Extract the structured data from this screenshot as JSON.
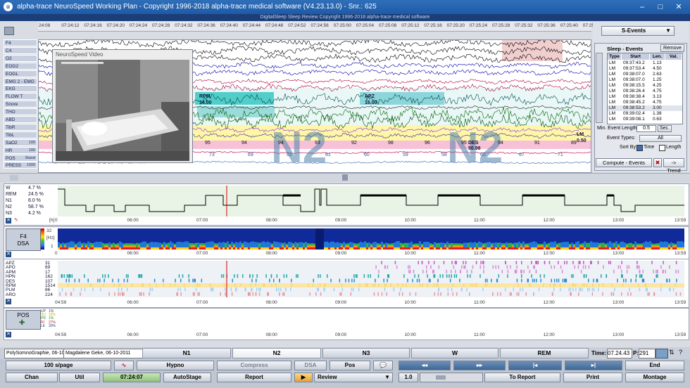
{
  "window": {
    "title": "alpha-trace NeuroSpeed Working Plan - Copyright 1996-2018 alpha-trace medical software (V4.23.13.0) - Snr.: 625",
    "subtitle": "DigitalSleep Sleep Review    Copyright 1996-2018 alpha-trace medical software",
    "app_icon": "α"
  },
  "timeline": {
    "ticks": [
      "24:08",
      "07:24:12",
      "07:24:16",
      "07:24:20",
      "07:24:24",
      "07:24:28",
      "07:24:32",
      "07:24:36",
      "07:24:40",
      "07:24:44",
      "07:24:48",
      "07:24:52",
      "07:24:56",
      "07:25:00",
      "07:25:04",
      "07:25:08",
      "07:25:12",
      "07:25:16",
      "07:25:20",
      "07:25:24",
      "07:25:28",
      "07:25:32",
      "07:25:36",
      "07:25:40",
      "07:25:44"
    ]
  },
  "channels": [
    {
      "label": "F4",
      "value": ""
    },
    {
      "label": "C4",
      "value": ""
    },
    {
      "label": "O2",
      "value": ""
    },
    {
      "label": "EOG2",
      "value": ""
    },
    {
      "label": "EOGL",
      "value": ""
    },
    {
      "label": "EMG 2 - EMG 1",
      "value": ""
    },
    {
      "label": "EKG",
      "value": ""
    },
    {
      "label": "FLOW T",
      "value": ""
    },
    {
      "label": "Snore",
      "value": ""
    },
    {
      "label": "THO",
      "value": ""
    },
    {
      "label": "ABD",
      "value": ""
    },
    {
      "label": "TibR",
      "value": ""
    },
    {
      "label": "TibL",
      "value": ""
    },
    {
      "label": "SaO2",
      "value": "100"
    },
    {
      "label": "HR",
      "value": "100"
    },
    {
      "label": "POS",
      "value": "Stand"
    },
    {
      "label": "PRESS",
      "value": "1000"
    }
  ],
  "overlay": {
    "stage_text_1": "N2",
    "stage_text_2": "N2",
    "rpm_label": "RPM",
    "rpm_value": "14.00",
    "apz_label": "APZ",
    "apz_value": "16.00",
    "des_label": "DES",
    "des_value": "50.98",
    "lm_label": "LM",
    "lm_value": "0.50",
    "sao2_values": [
      "95",
      "95",
      "96",
      "95",
      "95",
      "94",
      "94",
      "93",
      "92",
      "98",
      "96",
      "95",
      "94",
      "91",
      "89"
    ],
    "hr_values": [
      "62",
      "63",
      "64",
      "71",
      "73",
      "69",
      "61",
      "61",
      "60",
      "59",
      "58",
      "60",
      "67",
      "71"
    ]
  },
  "video": {
    "title": "NeuroSpeed Video"
  },
  "right_panel": {
    "event_type": "S-Events",
    "section_title": "Sleep - Events",
    "remove_label": "Remove",
    "col_type": "Type",
    "col_start": "Start",
    "col_len": "Len.",
    "col_val": "Val.",
    "rows": [
      {
        "type": "LM",
        "start": "09:37:43.2",
        "len": "1.13",
        "val": ""
      },
      {
        "type": "LM",
        "start": "09:37:53.4",
        "len": "4.50",
        "val": ""
      },
      {
        "type": "LM",
        "start": "09:38:07.0",
        "len": "2.63",
        "val": ""
      },
      {
        "type": "LM",
        "start": "09:38:07.0",
        "len": "1.25",
        "val": ""
      },
      {
        "type": "LM",
        "start": "09:38:15.5",
        "len": "4.25",
        "val": ""
      },
      {
        "type": "LM",
        "start": "09:38:26.4",
        "len": "4.75",
        "val": ""
      },
      {
        "type": "LM",
        "start": "09:38:38.4",
        "len": "3.13",
        "val": ""
      },
      {
        "type": "LM",
        "start": "09:38:45.2",
        "len": "4.75",
        "val": ""
      },
      {
        "type": "LM",
        "start": "09:38:53.2",
        "len": "3.00",
        "val": ""
      },
      {
        "type": "LM",
        "start": "09:39:02.4",
        "len": "1.38",
        "val": ""
      },
      {
        "type": "LM",
        "start": "09:39:08.1",
        "len": "0.63",
        "val": ""
      }
    ],
    "min_event_length_label": "Min. Event Length:",
    "min_event_length_value": "0.5",
    "sec_label": "Sec.",
    "event_types_label": "Event Types:",
    "event_types_value": "All",
    "sort_by_label": "Sort By:",
    "sort_time": "Time",
    "sort_length": "Length",
    "compute_label": "Compute - Events",
    "trend_label": "-> Trend"
  },
  "hypnogram": {
    "stages": [
      {
        "name": "W",
        "pct": "4.7 %"
      },
      {
        "name": "REM",
        "pct": "24.5 %"
      },
      {
        "name": "N1",
        "pct": "8.0 %"
      },
      {
        "name": "N2",
        "pct": "58.7 %"
      },
      {
        "name": "N3",
        "pct": "4.2 %"
      }
    ],
    "unit": "[h]",
    "ticks": [
      "0",
      "06:00",
      "07:00",
      "08:00",
      "09:00",
      "10:00",
      "11:00",
      "12:00",
      "13:00",
      "13:59"
    ]
  },
  "dsa": {
    "channel": "F4",
    "label": "DSA",
    "unit": "[Hz]",
    "y_ticks": [
      "32",
      "1"
    ],
    "ticks": [
      "0",
      "06:00",
      "07:00",
      "08:00",
      "09:00",
      "10:00",
      "11:00",
      "12:00",
      "13:00",
      "13:59"
    ]
  },
  "event_rows": [
    {
      "name": "APZ",
      "count": "31"
    },
    {
      "name": "APO",
      "count": "69"
    },
    {
      "name": "APM",
      "count": "17"
    },
    {
      "name": "HPN",
      "count": "162"
    },
    {
      "name": "DES",
      "count": "107"
    },
    {
      "name": "RPM",
      "count": "1514"
    },
    {
      "name": "PLM",
      "count": "86"
    },
    {
      "name": "ARO",
      "count": "224"
    }
  ],
  "event_ticks": [
    "04:59",
    "06:00",
    "07:00",
    "08:00",
    "09:00",
    "10:00",
    "11:00",
    "12:00",
    "13:00",
    "13:59"
  ],
  "position": {
    "label": "POS",
    "legend": [
      {
        "name": "UP",
        "pct": "1%"
      },
      {
        "name": "SU",
        "pct": "33%"
      },
      {
        "name": "PR",
        "pct": "1%"
      },
      {
        "name": "RI",
        "pct": "27%"
      },
      {
        "name": "LE",
        "pct": "30%"
      }
    ],
    "ticks": [
      "04:59",
      "06:00",
      "07:00",
      "08:00",
      "09:00",
      "10:00",
      "11:00",
      "12:00",
      "13:00",
      "13:59"
    ]
  },
  "stage_bar": {
    "patient": "PolySomnoGraphie, 06-10-2",
    "patient2": "Magdalene Geke, 06-10-2011",
    "stages": [
      "N1",
      "N2",
      "N3",
      "W",
      "REM"
    ],
    "time_label": "Time:",
    "time_value": "07.24.43",
    "page_label": "P:",
    "page_value": "291"
  },
  "bottom": {
    "page_select": "100 s/page",
    "hypno": "Hypno",
    "compress": "Compress",
    "dsa": "DSA",
    "pos": "Pos",
    "chan": "Chan",
    "util": "Util",
    "time": "07:24:07",
    "autostage": "AutoStage",
    "report": "Report",
    "review": "Review",
    "speed": "1.0",
    "to_report": "To Report",
    "print": "Print",
    "end": "End",
    "montage": "Montage",
    "nav_back_fast": "◂◂",
    "nav_fwd_fast": "▸▸",
    "nav_back": "|◂",
    "nav_fwd": "▸|"
  }
}
